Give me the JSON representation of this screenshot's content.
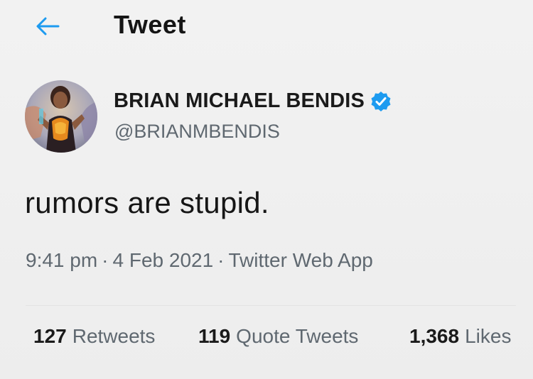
{
  "header": {
    "title": "Tweet",
    "back_icon": "arrow-left-icon"
  },
  "author": {
    "display_name": "BRIAN MICHAEL BENDIS",
    "handle": "@BRIANMBENDIS",
    "verified_icon": "verified-badge-icon",
    "verified_color": "#1d9bf0"
  },
  "tweet": {
    "text": "rumors are stupid.",
    "time": "9:41 pm",
    "date": "4 Feb 2021",
    "separator": "·",
    "source": "Twitter Web App"
  },
  "stats": {
    "retweets": {
      "count": "127",
      "label": "Retweets"
    },
    "quote_tweets": {
      "count": "119",
      "label": "Quote Tweets"
    },
    "likes": {
      "count": "1,368",
      "label": "Likes"
    }
  },
  "colors": {
    "accent": "#1d9bf0",
    "text_primary": "#1a1a1a",
    "text_secondary": "#5f6870",
    "background": "#f0f0f0"
  }
}
